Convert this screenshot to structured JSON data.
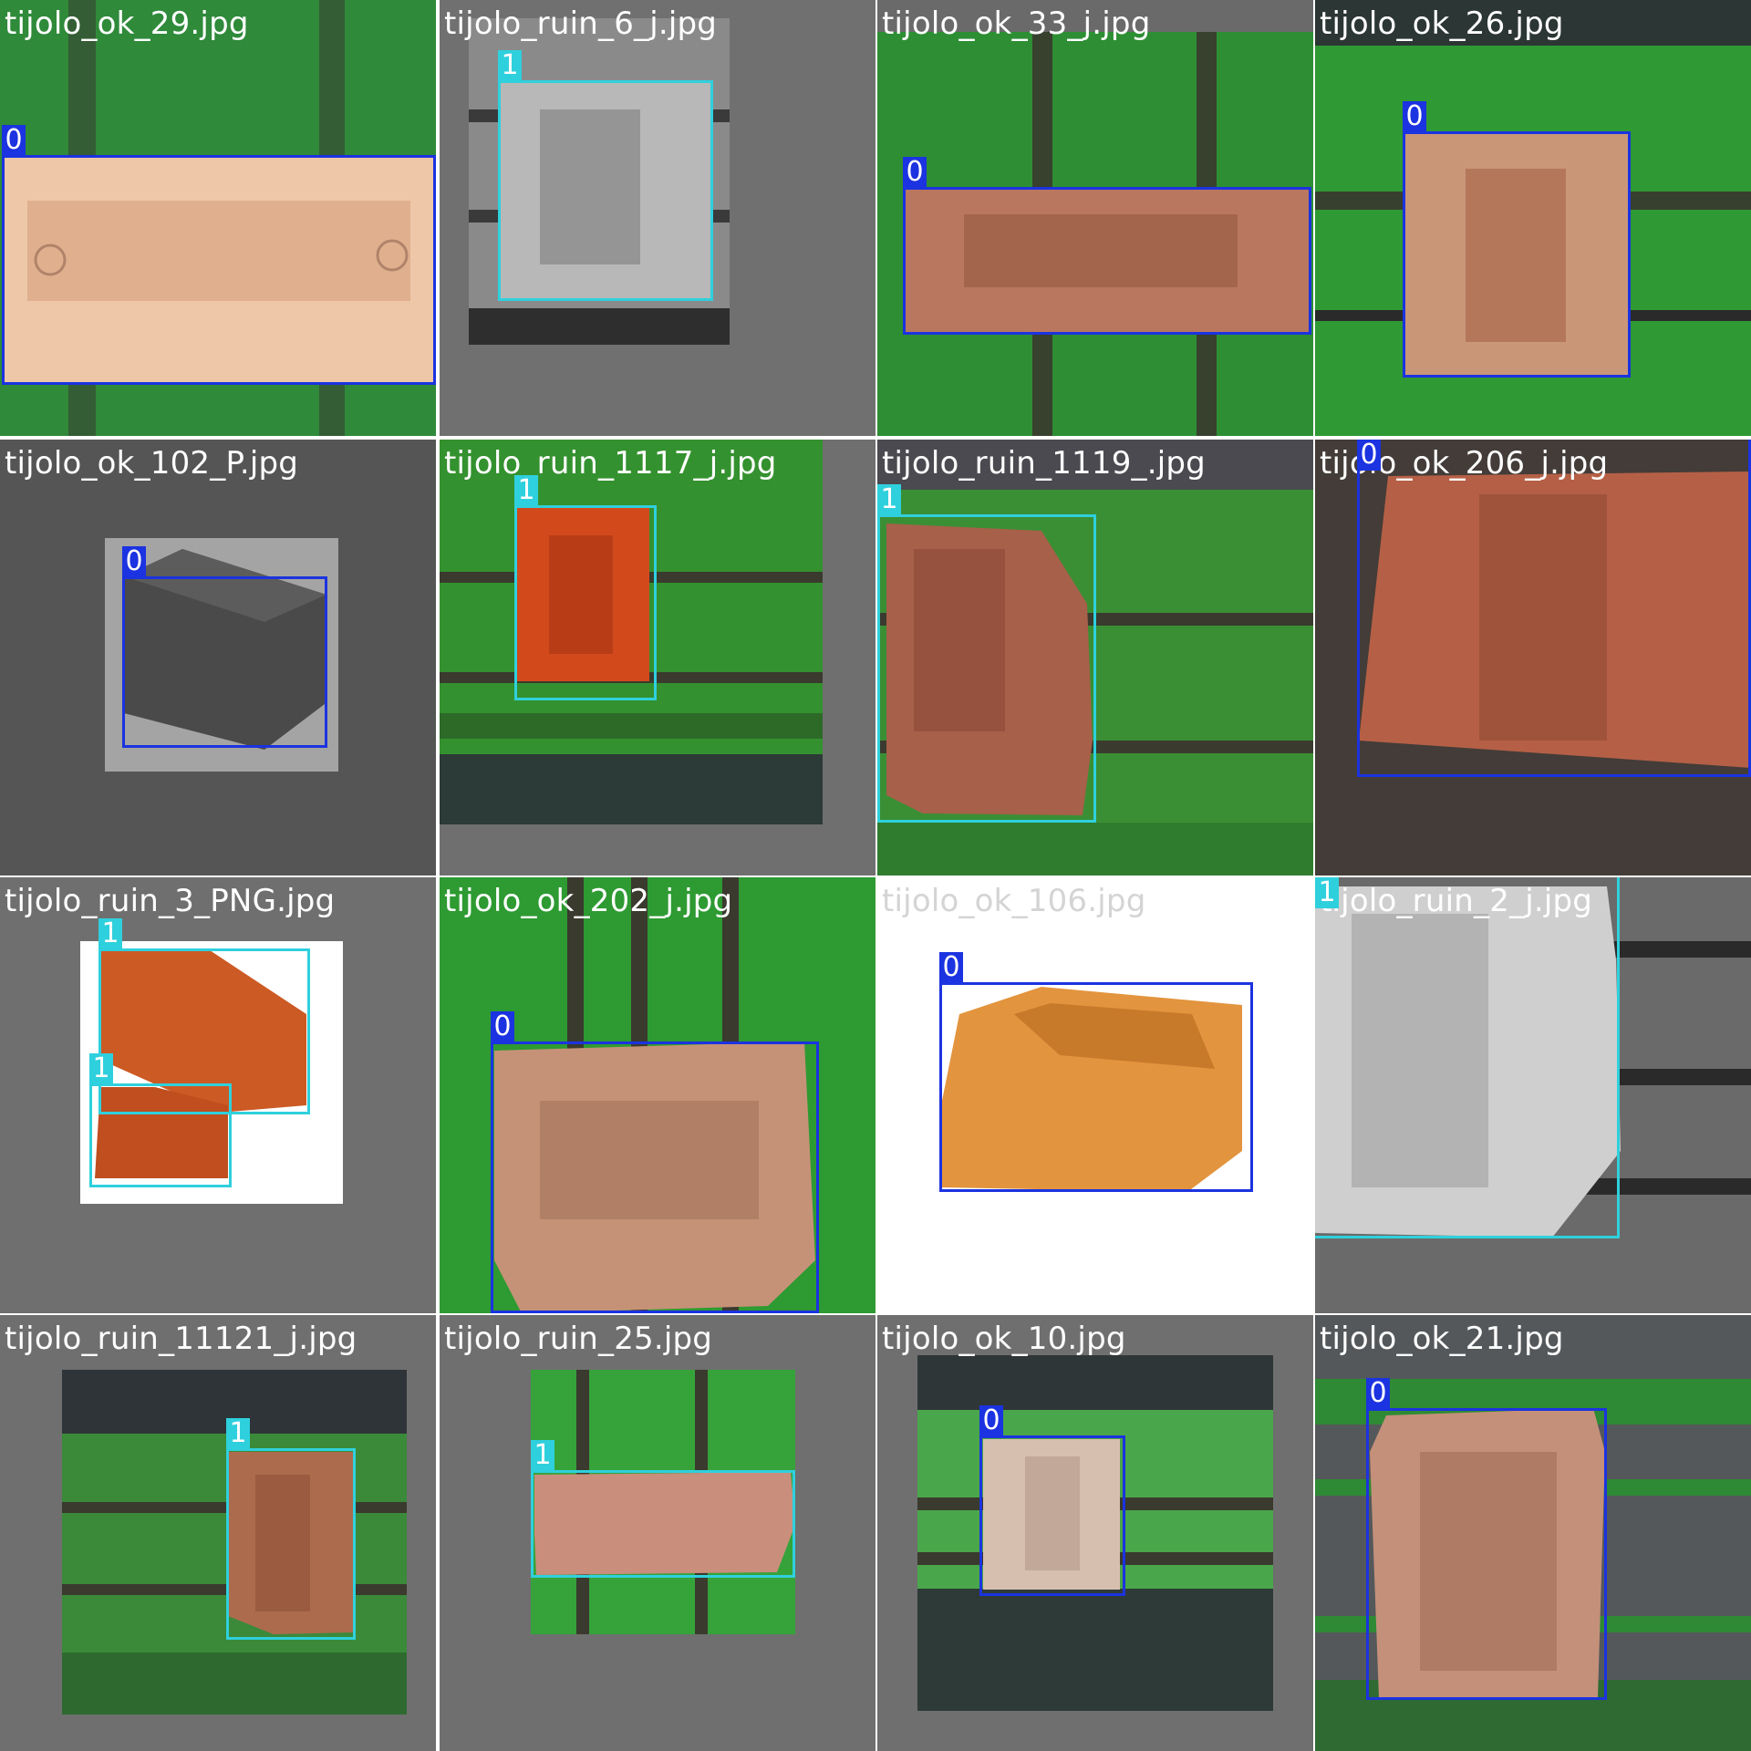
{
  "class_colors": {
    "0": "#1b33e0",
    "1": "#2fd0dd"
  },
  "tiles": [
    {
      "filename": "tijolo_ok_29.jpg",
      "labels": [
        "0"
      ]
    },
    {
      "filename": "tijolo_ruin_6_j.jpg",
      "labels": [
        "1"
      ]
    },
    {
      "filename": "tijolo_ok_33_j.jpg",
      "labels": [
        "0"
      ]
    },
    {
      "filename": "tijolo_ok_26.jpg",
      "labels": [
        "0"
      ]
    },
    {
      "filename": "tijolo_ok_102_P.jpg",
      "labels": [
        "0"
      ]
    },
    {
      "filename": "tijolo_ruin_1117_j.jpg",
      "labels": [
        "1"
      ]
    },
    {
      "filename": "tijolo_ruin_1119_.jpg",
      "labels": [
        "1"
      ]
    },
    {
      "filename": "tijolo_ok_206_j.jpg",
      "labels": [
        "0"
      ]
    },
    {
      "filename": "tijolo_ruin_3_PNG.jpg",
      "labels": [
        "1",
        "1"
      ]
    },
    {
      "filename": "tijolo_ok_202_j.jpg",
      "labels": [
        "0"
      ]
    },
    {
      "filename": "tijolo_ok_106.jpg",
      "labels": [
        "0"
      ]
    },
    {
      "filename": "tijolo_ruin_2_j.jpg",
      "labels": [
        "1"
      ]
    },
    {
      "filename": "tijolo_ruin_11121_j.jpg",
      "labels": [
        "1"
      ]
    },
    {
      "filename": "tijolo_ruin_25.jpg",
      "labels": [
        "1"
      ]
    },
    {
      "filename": "tijolo_ok_10.jpg",
      "labels": [
        "0"
      ]
    },
    {
      "filename": "tijolo_ok_21.jpg",
      "labels": [
        "0"
      ]
    }
  ]
}
